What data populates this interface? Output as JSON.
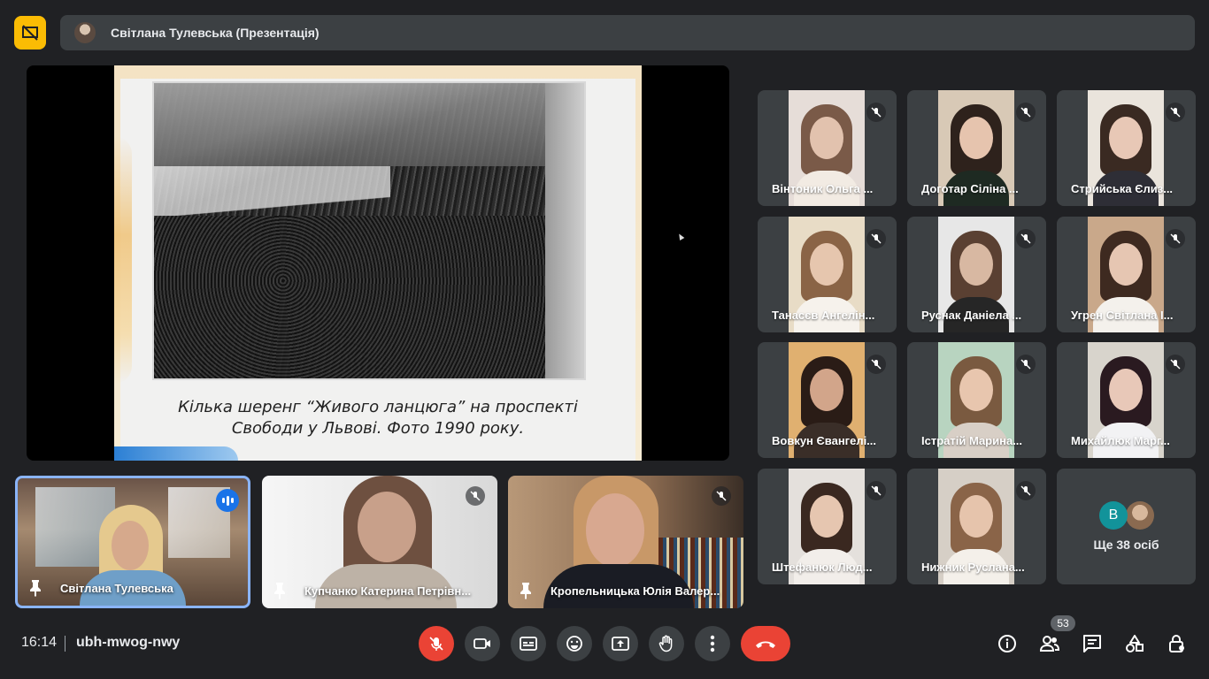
{
  "header": {
    "title": "Світлана Тулевська (Презентація)"
  },
  "presentation": {
    "caption_line1": "Кілька шеренг “Живого ланцюга” на проспекті",
    "caption_line2": "Свободи у Львові. Фото 1990 року."
  },
  "participants": [
    {
      "name": "Вінтоник Ольга ...",
      "muted": true
    },
    {
      "name": "Доготар Сіліна ...",
      "muted": true
    },
    {
      "name": "Стрийська Єлиз...",
      "muted": true
    },
    {
      "name": "Танасєв Ангелін...",
      "muted": true
    },
    {
      "name": "Руснак Даніела ...",
      "muted": true
    },
    {
      "name": "Угрен Світлана І...",
      "muted": true
    },
    {
      "name": "Вовкун Євангелі...",
      "muted": true
    },
    {
      "name": "Істратій Марина...",
      "muted": true
    },
    {
      "name": "Михайлюк Марг...",
      "muted": true
    },
    {
      "name": "Штефанюк Люд...",
      "muted": true
    },
    {
      "name": "Нижник Руслана...",
      "muted": true
    }
  ],
  "more_tile": {
    "avatar_letter": "В",
    "label": "Ще 38 осіб"
  },
  "pinned": [
    {
      "name": "Світлана Тулевська",
      "speaking": true
    },
    {
      "name": "Купчанко Катерина Петрівн...",
      "muted": true
    },
    {
      "name": "Кропельницька Юлія Валер...",
      "muted": true
    }
  ],
  "footer": {
    "time": "16:14",
    "meeting_code": "ubh-mwog-nwy",
    "people_count": "53"
  },
  "colors": {
    "background": "#202124",
    "tile": "#3c4043",
    "danger": "#ea4335",
    "accent": "#8ab4f8",
    "brand_yellow": "#fbbc04"
  }
}
